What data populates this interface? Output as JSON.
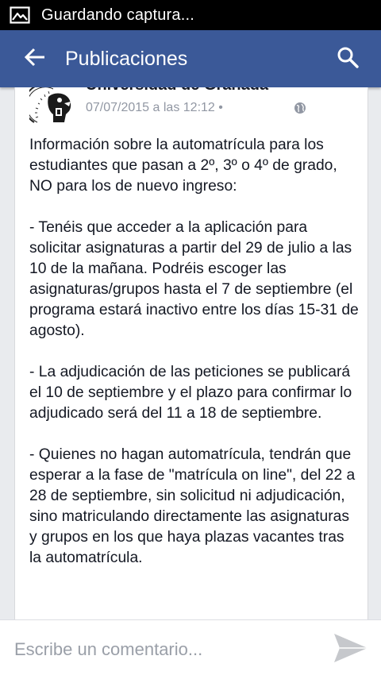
{
  "status_bar": {
    "notification_icon": "image-icon",
    "text": "Guardando captura..."
  },
  "app_bar": {
    "back_icon": "arrow-left-icon",
    "title": "Publicaciones",
    "search_icon": "search-icon",
    "background": "#3b5998"
  },
  "post": {
    "page_name": "Universidad de Granada",
    "meta": "07/07/2015 a las 12:12 •",
    "privacy_icon": "globe-icon",
    "paragraphs": [
      "Información sobre la automatrícula para los estudiantes que pasan a 2º, 3º o 4º de grado, NO para los de nuevo ingreso:",
      "- Tenéis que acceder a la aplicación para solicitar asignaturas a partir del 29 de julio a las 10 de la mañana. Podréis escoger las asignaturas/grupos hasta el 7 de septiembre (el programa estará inactivo entre los días 15-31 de agosto).",
      "- La adjudicación de las peticiones se publicará el 10 de septiembre y el plazo para confirmar lo adjudicado será del 11 a 18 de septiembre.",
      "- Quienes  no hagan automatrícula, tendrán que esperar a la fase de \"matrícula on line\", del 22 a 28 de septiembre, sin solicitud ni adjudicación, sino matriculando directamente las asignaturas y grupos en los que haya plazas vacantes tras la automatrícula."
    ]
  },
  "comment_bar": {
    "placeholder": "Escribe un comentario...",
    "send_icon": "send-icon"
  }
}
